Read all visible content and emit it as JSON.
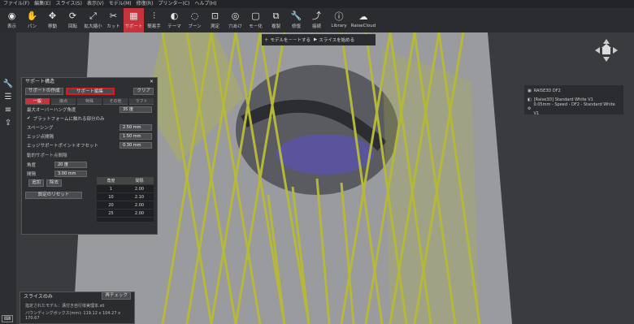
{
  "menu": [
    "ファイル(F)",
    "編集(E)",
    "スライス(S)",
    "表示(V)",
    "モデル(M)",
    "修復(R)",
    "プリンター(C)",
    "ヘルプ(H)"
  ],
  "toolbar": [
    {
      "label": "表示",
      "icon": "eye-icon",
      "glyph": "◉"
    },
    {
      "label": "パン",
      "icon": "hand-icon",
      "glyph": "✋"
    },
    {
      "label": "移動",
      "icon": "move-icon",
      "glyph": "✥"
    },
    {
      "label": "回転",
      "icon": "rotate-icon",
      "glyph": "⟳"
    },
    {
      "label": "拡大縮小",
      "icon": "scale-icon",
      "glyph": "⤢"
    },
    {
      "label": "カット",
      "icon": "cut-icon",
      "glyph": "✂"
    },
    {
      "label": "サポート",
      "icon": "support-icon",
      "glyph": "▦",
      "active": true
    },
    {
      "label": "簡易手",
      "icon": "adjust-icon",
      "glyph": "⫶"
    },
    {
      "label": "テーマ",
      "icon": "theme-icon",
      "glyph": "◐"
    },
    {
      "label": "ブーン",
      "icon": "boom-icon",
      "glyph": "◌"
    },
    {
      "label": "測定",
      "icon": "measure-icon",
      "glyph": "⊡"
    },
    {
      "label": "穴あけ",
      "icon": "hole-icon",
      "glyph": "◎"
    },
    {
      "label": "モ－化",
      "icon": "model-icon",
      "glyph": "▢"
    },
    {
      "label": "複製",
      "icon": "copy-icon",
      "glyph": "⧉"
    },
    {
      "label": "修復",
      "icon": "repair-icon",
      "glyph": "🔧"
    },
    {
      "label": "接続",
      "icon": "link-icon",
      "glyph": "⤴"
    },
    {
      "label": "Library",
      "icon": "library-icon",
      "glyph": "ⓘ"
    },
    {
      "label": "RaiseCloud",
      "icon": "cloud-icon",
      "glyph": "☁"
    }
  ],
  "topbar": {
    "add_model": "モデルを－－トする",
    "start_slice": "スライスを始める"
  },
  "support_panel": {
    "title": "サポート構造",
    "create_btn": "サポートの作成",
    "edit_btn": "サポート編集",
    "clear_btn": "クリア",
    "tabs": [
      "一般",
      "接点",
      "特殊",
      "その他",
      "ラフト"
    ],
    "overhang_label": "最大オーバーハング角度",
    "overhang_value": "35 度",
    "platform_only": "プラットフォームに触れる部分のみ",
    "spacing_label": "スペーシング",
    "spacing_value": "2.50 mm",
    "edge_label": "エッジ点間隔",
    "edge_value": "1.50 mm",
    "offset_label": "エッジサポートポイントオフセット",
    "offset_value": "0.30 mm",
    "dynamic_label": "動的サポート点間隔",
    "angle_label": "角度",
    "angle_value": "20 度",
    "interval_label": "間隔",
    "interval_value": "3.00 mm",
    "add_btn": "追加",
    "remove_btn": "除去",
    "reset_btn": "設定のリセット",
    "table_head": [
      "角度",
      "間隔"
    ],
    "table_rows": [
      [
        "1",
        "2.00"
      ],
      [
        "10",
        "2.10"
      ],
      [
        "20",
        "2.00"
      ],
      [
        "25",
        "2.00"
      ]
    ]
  },
  "right_panel": {
    "printer": "RAISE3D DF2",
    "material": "[Raise3D] Standard White V1",
    "profile": "0.05mm - Speed - DF2 - Standard White V1"
  },
  "bottom_panel": {
    "title": "スライスのみ",
    "check_btn": "再チェック",
    "line1": "指定されたモデル：溝付き自行体実理本.stl",
    "line2": "バウンディングボックス(mm): 119.12 x 104.27 x 170.67"
  }
}
